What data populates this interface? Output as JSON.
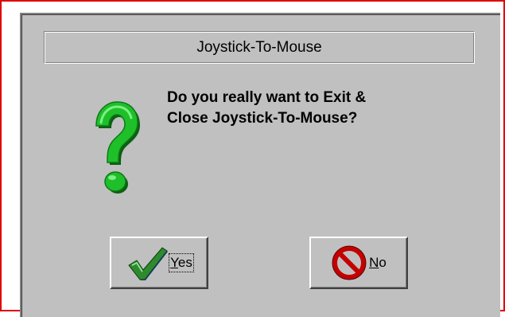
{
  "dialog": {
    "title": "Joystick-To-Mouse",
    "message_line1": "Do you really want to Exit &",
    "message_line2": "Close Joystick-To-Mouse?",
    "icon": "question-mark-icon"
  },
  "buttons": {
    "yes": {
      "label_mnemonic": "Y",
      "label_rest": "es",
      "icon": "checkmark-icon"
    },
    "no": {
      "label_mnemonic": "N",
      "label_rest": "o",
      "icon": "no-sign-icon"
    }
  },
  "colors": {
    "frame_highlight": "#e00000",
    "dialog_face": "#c0c0c0",
    "question_green": "#1fbf2a",
    "check_green": "#2f8a2f",
    "check_blue": "#1f3fa8",
    "no_red": "#c40000"
  }
}
